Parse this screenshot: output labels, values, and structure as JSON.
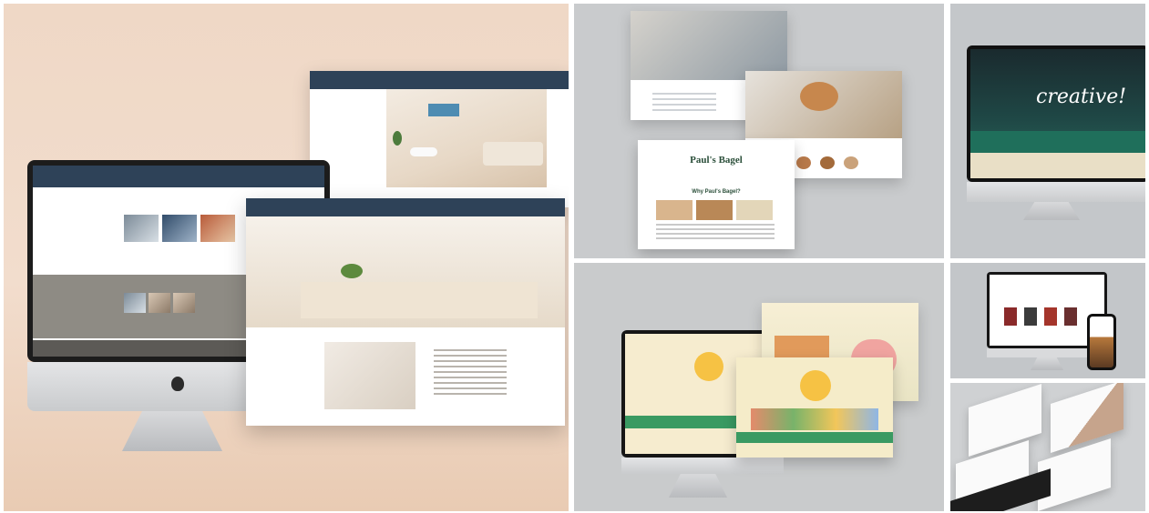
{
  "tiles": {
    "bagel_site": {
      "card_title": "Paul's Bagel",
      "section_title": "Why Paul's Bagel?"
    },
    "creative_site": {
      "hero_text": "creative!"
    }
  },
  "colors": {
    "navy_header": "#2e4258",
    "green_accent": "#1f6f5b",
    "beige_bg": "#efd8c6",
    "gray_bg": "#c9cbcd"
  }
}
